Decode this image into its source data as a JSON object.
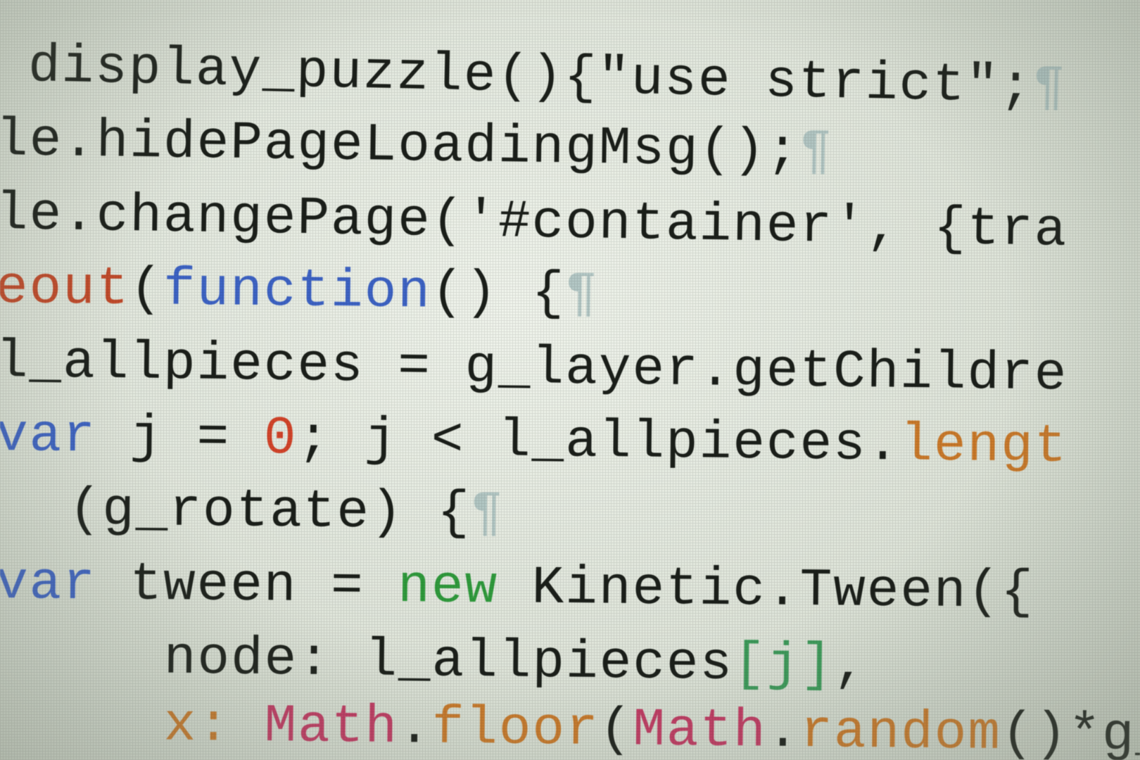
{
  "colors": {
    "default": "#1b1f1a",
    "keyword": "#3d63c4",
    "string": "#2a2e2a",
    "number": "#d2442a",
    "property": "#c9792a",
    "builtin": "#c23a63",
    "function_name": "#c24a2a",
    "literal_new": "#2f9a3c",
    "bracket": "#3d9a5a",
    "pilcrow": "#9fb8b8"
  },
  "code_lines": [
    [
      {
        "t": "display_puzzle(){\"use strict\";",
        "c": "default"
      },
      {
        "t": "¶",
        "c": "pilcrow"
      }
    ],
    [
      {
        "t": "le.hidePageLoadingMsg();",
        "c": "default"
      },
      {
        "t": "¶",
        "c": "pilcrow"
      }
    ],
    [
      {
        "t": "le.changePage('#container', {tra",
        "c": "default"
      }
    ],
    [
      {
        "t": "eout",
        "c": "function_name"
      },
      {
        "t": "(",
        "c": "default"
      },
      {
        "t": "function",
        "c": "keyword"
      },
      {
        "t": "() {",
        "c": "default"
      },
      {
        "t": "¶",
        "c": "pilcrow"
      }
    ],
    [
      {
        "t": "l_allpieces = g_layer.getChildre",
        "c": "default"
      }
    ],
    [
      {
        "t": "var",
        "c": "keyword"
      },
      {
        "t": " j = ",
        "c": "default"
      },
      {
        "t": "0",
        "c": "number"
      },
      {
        "t": "; j < l_allpieces.",
        "c": "default"
      },
      {
        "t": "lengt",
        "c": "property"
      }
    ],
    [
      {
        "t": " (g_rotate) {",
        "c": "default"
      },
      {
        "t": "¶",
        "c": "pilcrow"
      }
    ],
    [
      {
        "t": "var",
        "c": "keyword"
      },
      {
        "t": " tween = ",
        "c": "default"
      },
      {
        "t": "new",
        "c": "literal_new"
      },
      {
        "t": " Kinetic.Tween({",
        "c": "default"
      }
    ],
    [
      {
        "t": "   node: l_allpieces",
        "c": "default"
      },
      {
        "t": "[j]",
        "c": "bracket"
      },
      {
        "t": ",",
        "c": "default"
      }
    ],
    [
      {
        "t": "   x: ",
        "c": "property"
      },
      {
        "t": "Math",
        "c": "builtin"
      },
      {
        "t": ".",
        "c": "default"
      },
      {
        "t": "floor",
        "c": "property"
      },
      {
        "t": "(",
        "c": "default"
      },
      {
        "t": "Math",
        "c": "builtin"
      },
      {
        "t": ".",
        "c": "default"
      },
      {
        "t": "random",
        "c": "property"
      },
      {
        "t": "()*g_b",
        "c": "default"
      }
    ]
  ]
}
